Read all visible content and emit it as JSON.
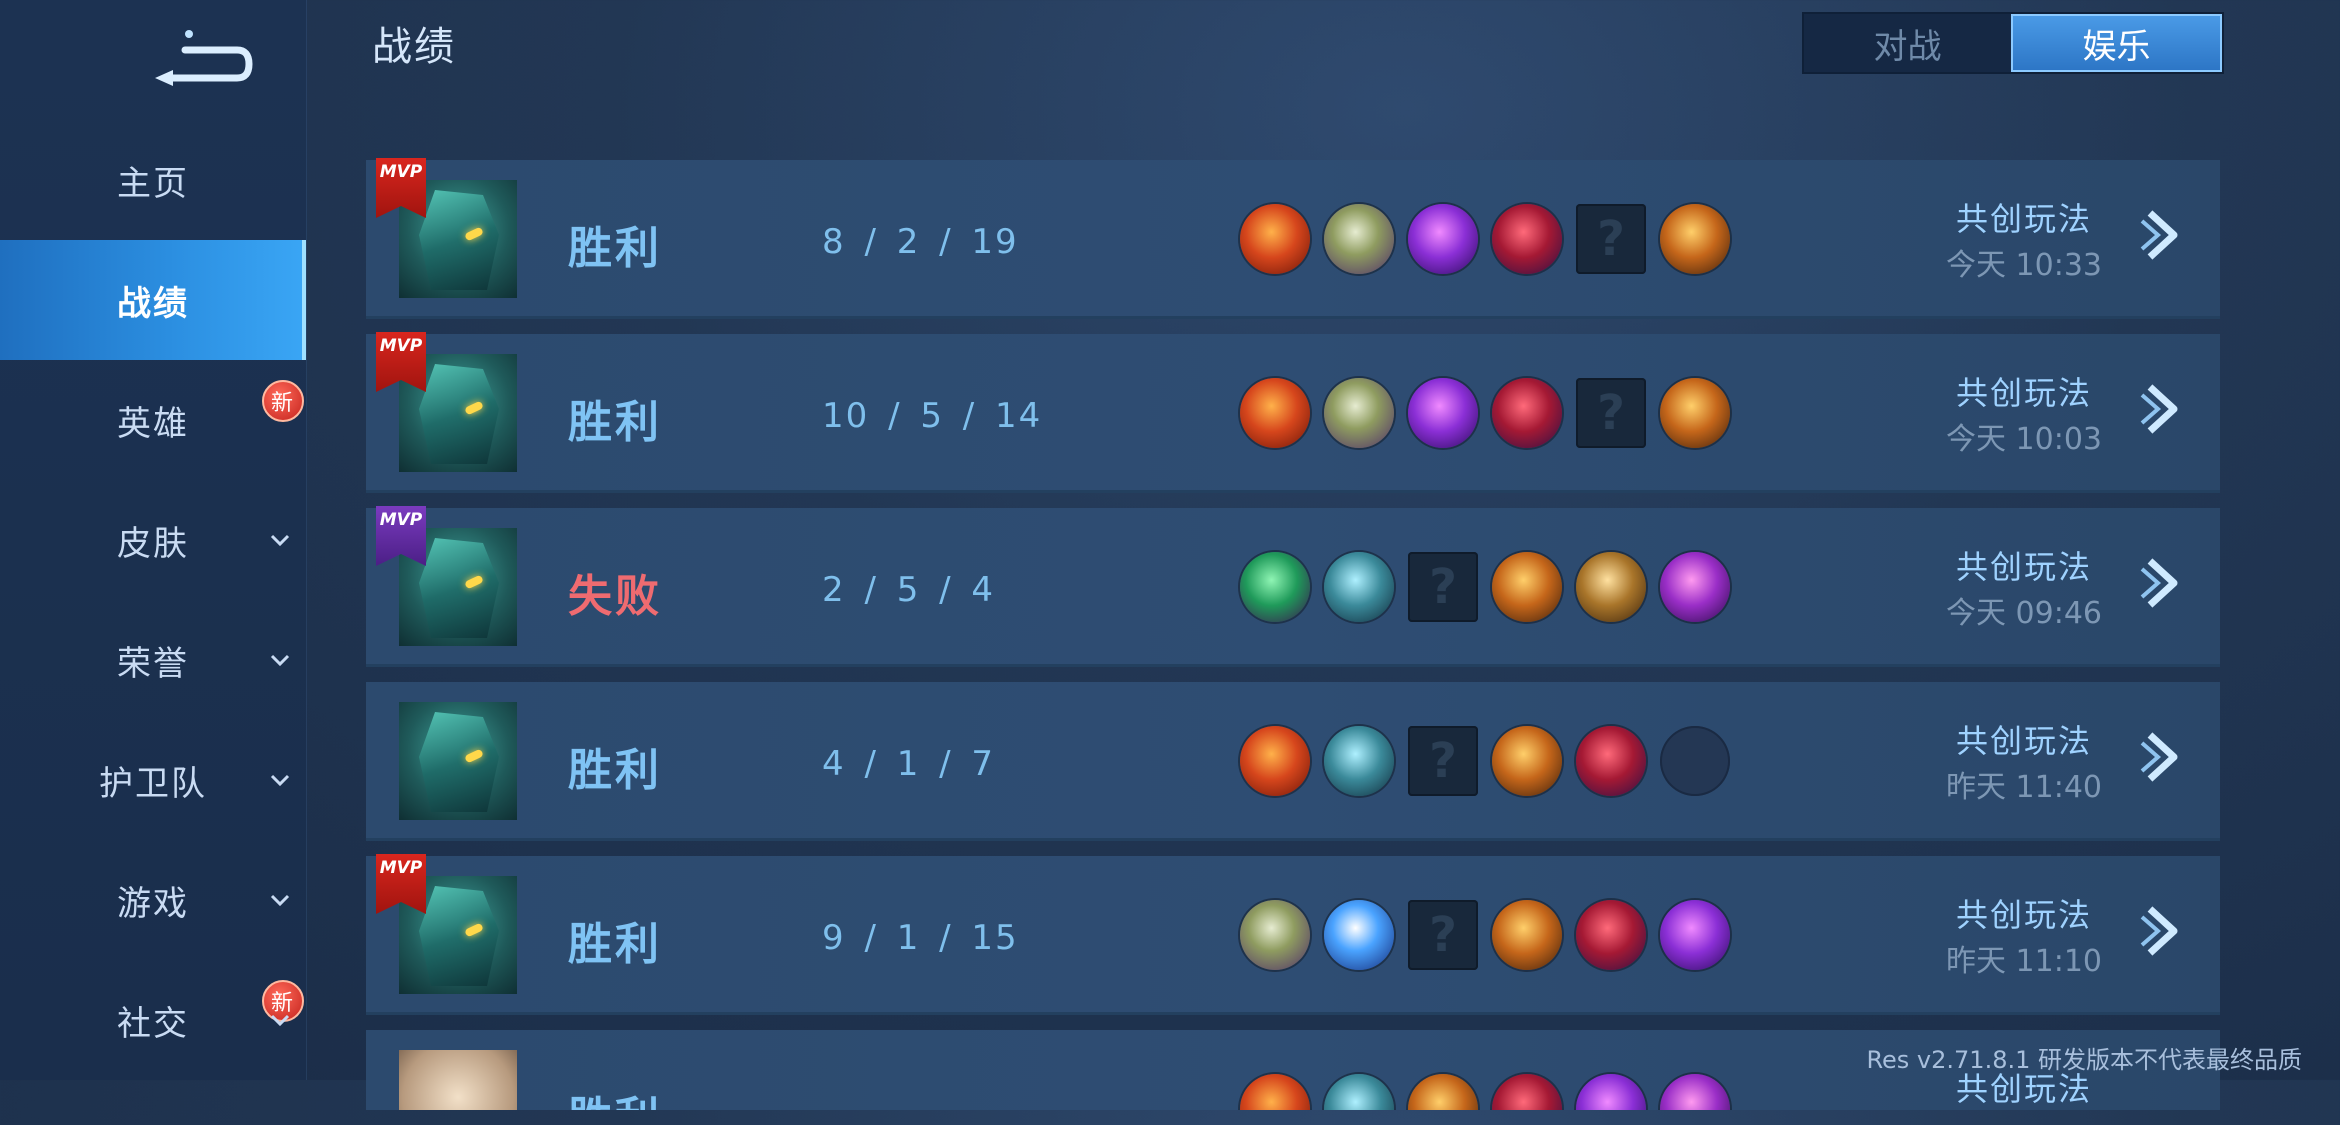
{
  "sidebar": {
    "items": [
      {
        "label": "主页"
      },
      {
        "label": "战绩"
      },
      {
        "label": "英雄",
        "badge": "新"
      },
      {
        "label": "皮肤"
      },
      {
        "label": "荣誉"
      },
      {
        "label": "护卫队"
      },
      {
        "label": "游戏"
      },
      {
        "label": "社交",
        "badge": "新"
      }
    ]
  },
  "header": {
    "title": "战绩",
    "tabs": [
      {
        "label": "对战"
      },
      {
        "label": "娱乐"
      }
    ]
  },
  "mvp_label": "MVP",
  "unknown_glyph": "?",
  "records": [
    {
      "result": "胜利",
      "kda": "8 / 2 / 19",
      "mode": "共创玩法",
      "time": "今天 10:33"
    },
    {
      "result": "胜利",
      "kda": "10 / 5 / 14",
      "mode": "共创玩法",
      "time": "今天 10:03"
    },
    {
      "result": "失败",
      "kda": "2 / 5 / 4",
      "mode": "共创玩法",
      "time": "今天 09:46"
    },
    {
      "result": "胜利",
      "kda": "4 / 1 / 7",
      "mode": "共创玩法",
      "time": "昨天 11:40"
    },
    {
      "result": "胜利",
      "kda": "9 / 1 / 15",
      "mode": "共创玩法",
      "time": "昨天 11:10"
    },
    {
      "result": "胜利",
      "mode": "共创玩法"
    }
  ],
  "footer": {
    "note": "Res v2.71.8.1 研发版本不代表最终品质"
  }
}
